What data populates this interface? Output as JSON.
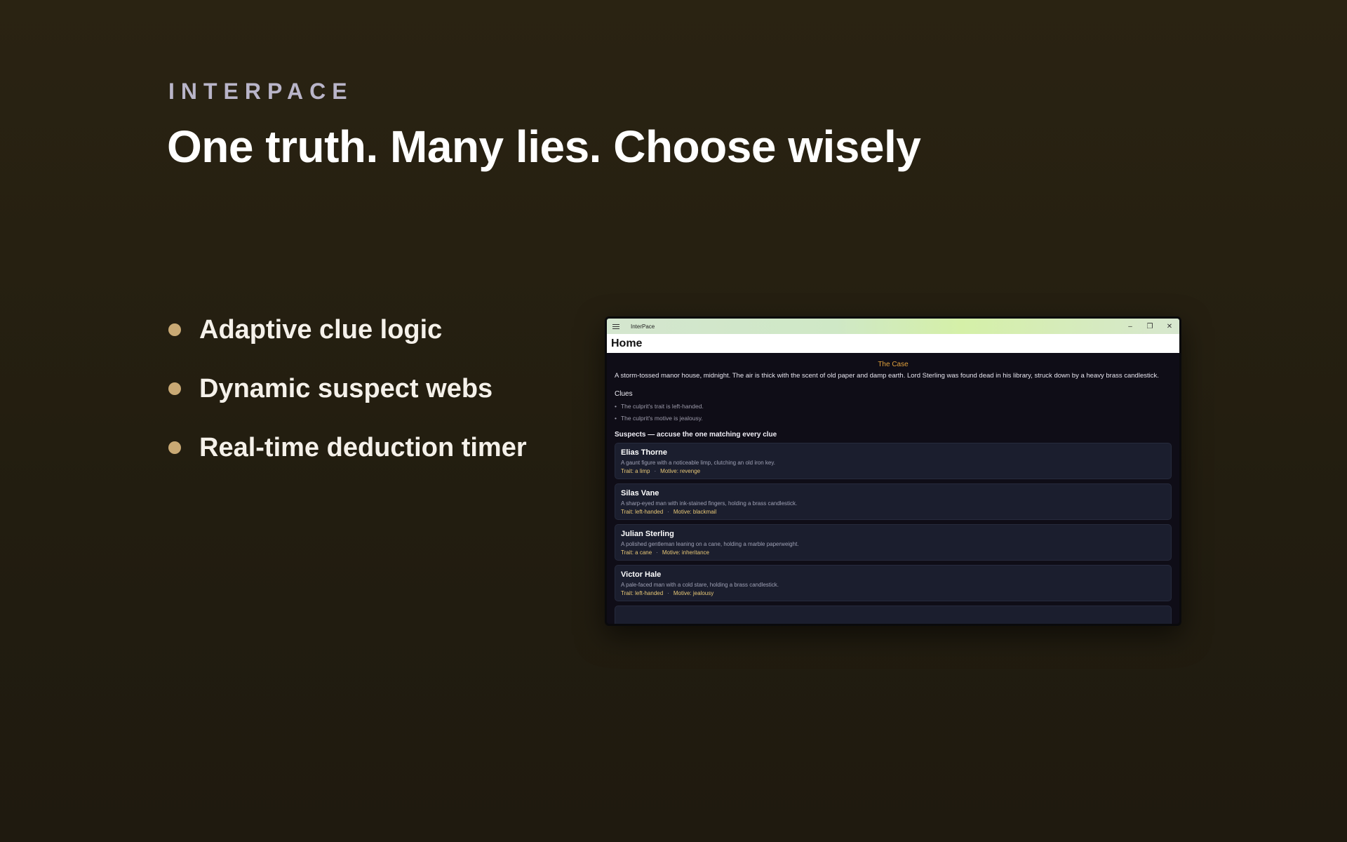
{
  "brand": "INTERPACE",
  "headline": "One truth. Many lies. Choose wisely",
  "features": [
    "Adaptive clue logic",
    "Dynamic suspect webs",
    "Real-time deduction timer"
  ],
  "app": {
    "window_title": "InterPace",
    "page_title": "Home",
    "case_title": "The Case",
    "case_text": "A storm-tossed manor house, midnight. The air is thick with the scent of old paper and damp earth. Lord Sterling was found dead in his library, struck down by a heavy brass candlestick.",
    "clues_title": "Clues",
    "clues": [
      "The culprit's trait is left-handed.",
      "The culprit's motive is jealousy."
    ],
    "suspects_title": "Suspects — accuse the one matching every clue",
    "suspects": [
      {
        "name": "Elias Thorne",
        "desc": "A gaunt figure with a noticeable limp, clutching an old iron key.",
        "trait": "Trait: a limp",
        "motive": "Motive: revenge"
      },
      {
        "name": "Silas Vane",
        "desc": "A sharp-eyed man with ink-stained fingers, holding a brass candlestick.",
        "trait": "Trait: left-handed",
        "motive": "Motive: blackmail"
      },
      {
        "name": "Julian Sterling",
        "desc": "A polished gentleman leaning on a cane, holding a marble paperweight.",
        "trait": "Trait: a cane",
        "motive": "Motive: inheritance"
      },
      {
        "name": "Victor Hale",
        "desc": "A pale-faced man with a cold stare, holding a brass candlestick.",
        "trait": "Trait: left-handed",
        "motive": "Motive: jealousy"
      }
    ],
    "sep": "·"
  },
  "colors": {
    "background": "#2a2312",
    "bullet": "#c9a974",
    "accent_case": "#e0a03c",
    "meta": "#e8c876"
  }
}
